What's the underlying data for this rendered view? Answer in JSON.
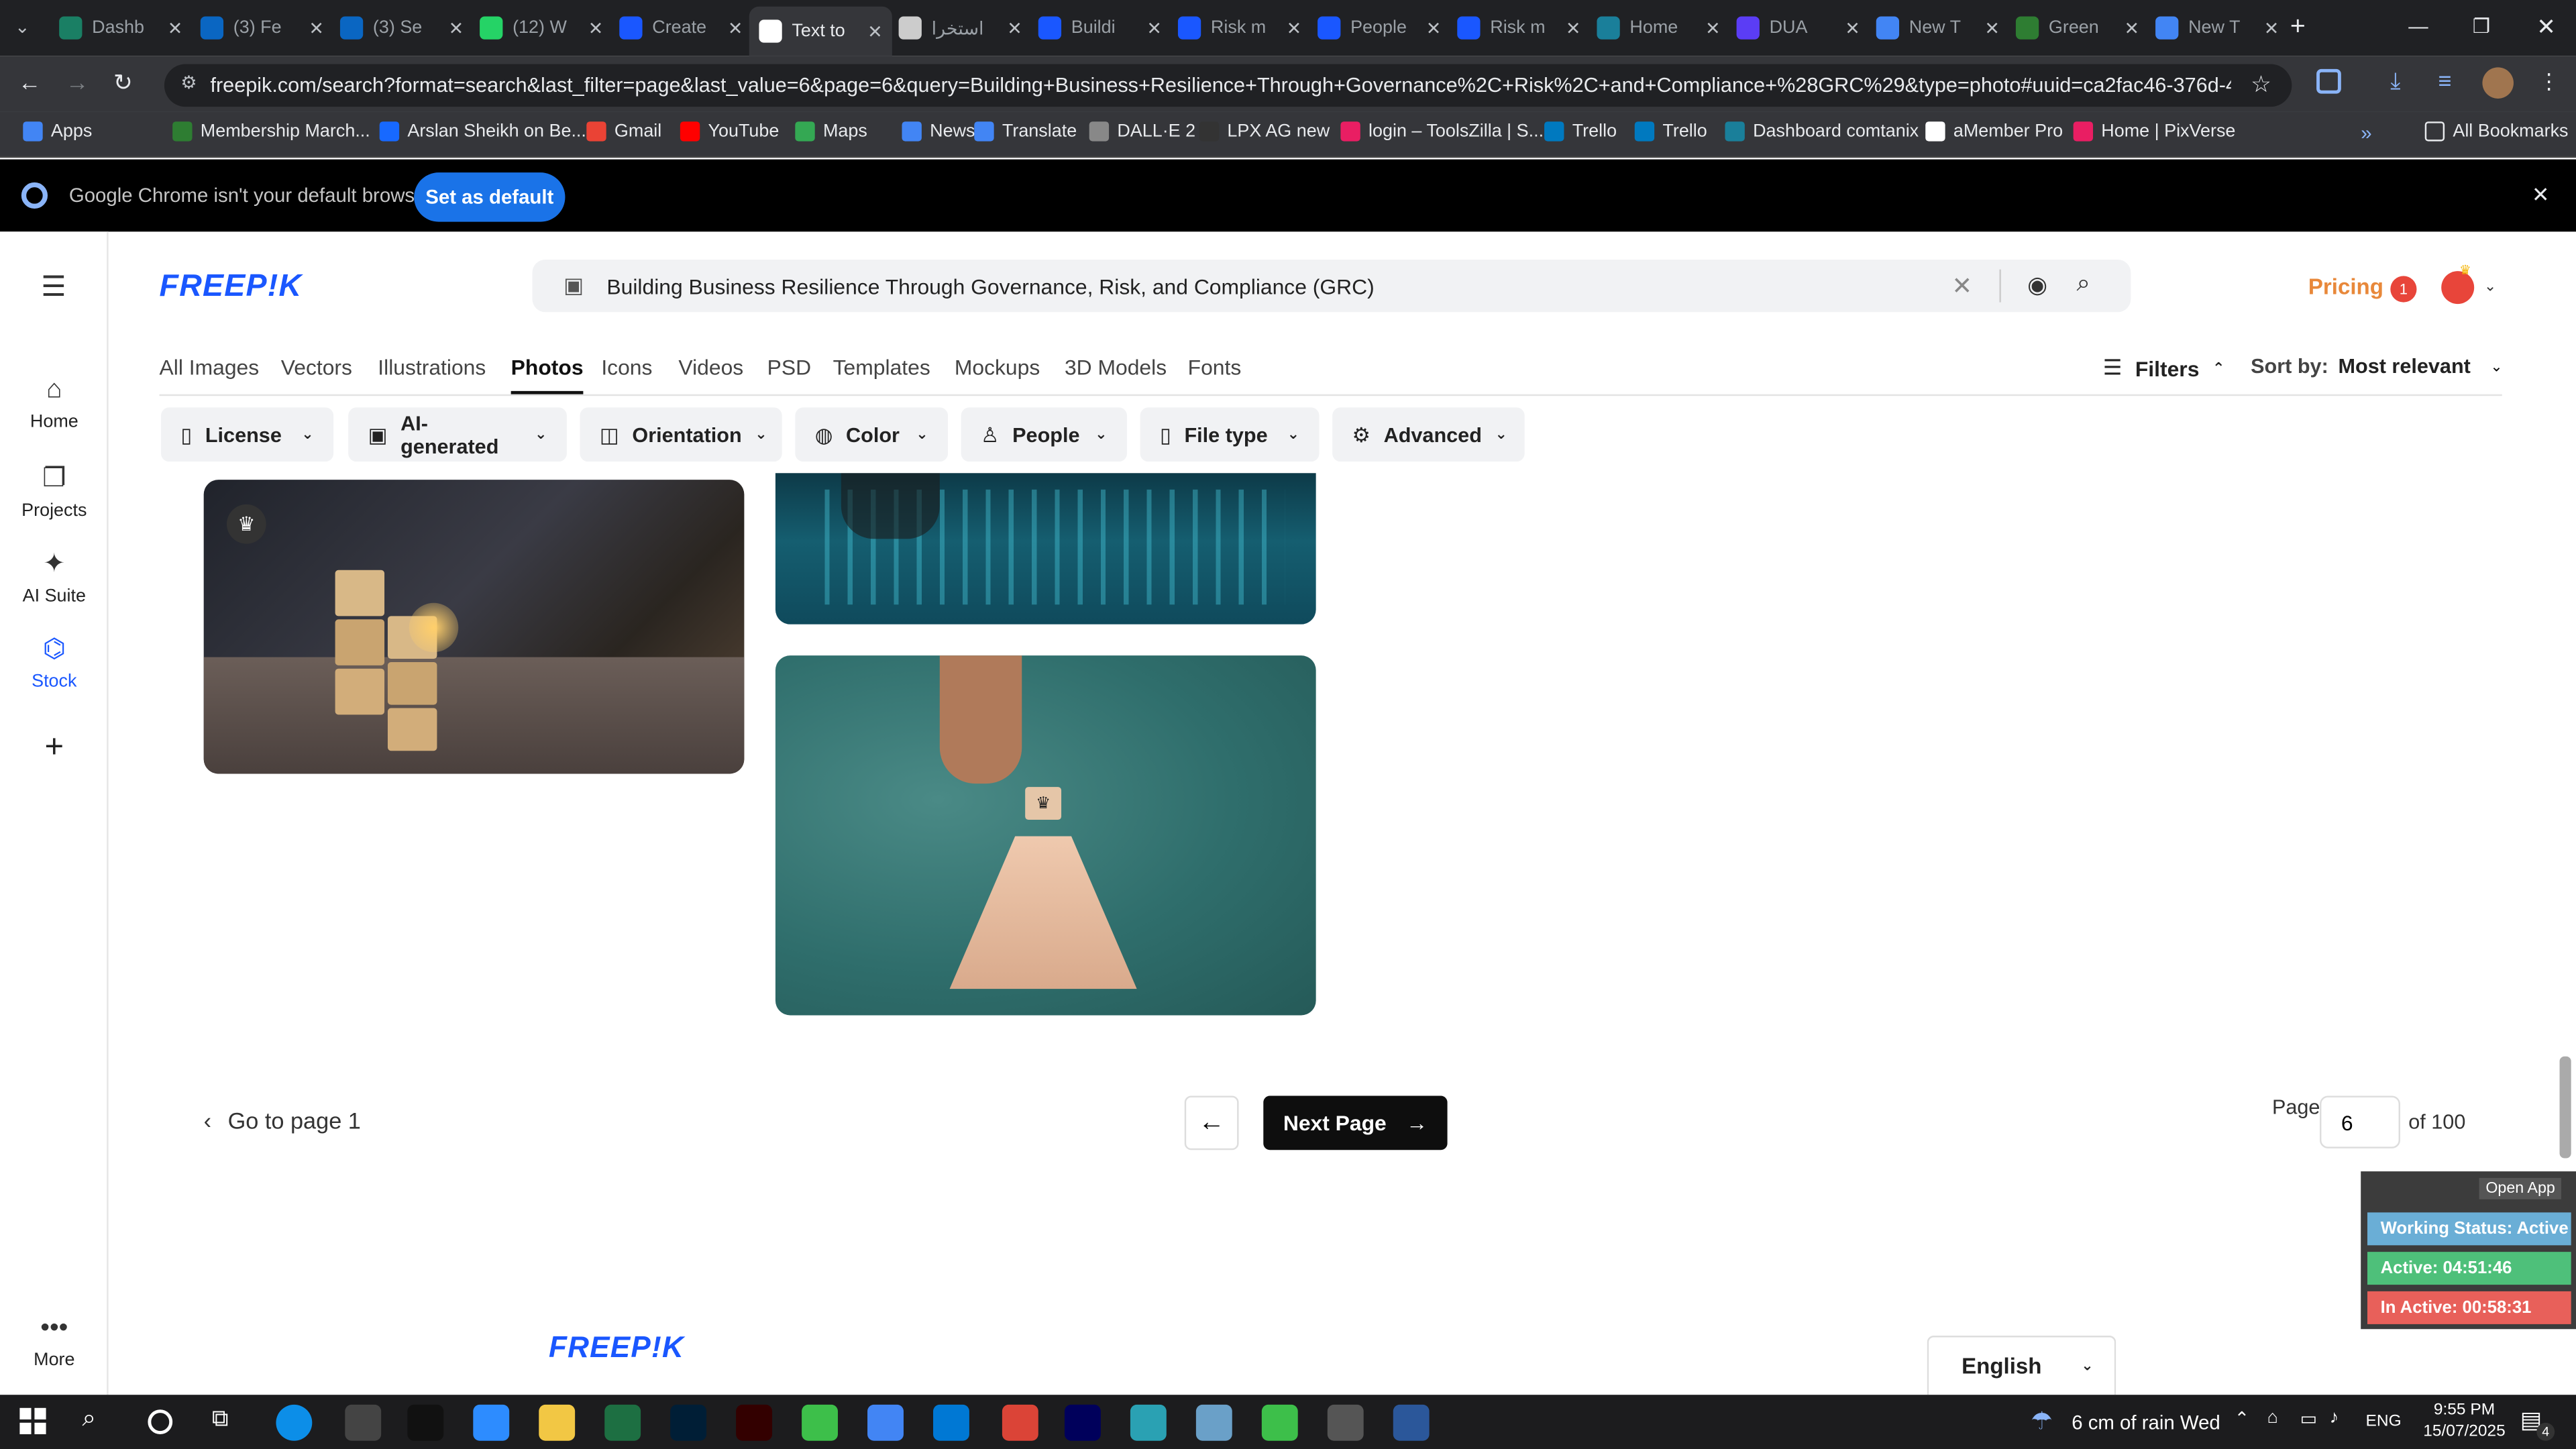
{
  "tabs": [
    {
      "label": "Dashb",
      "color": "#1a7f64"
    },
    {
      "label": "(3) Fe",
      "color": "#0a66c2"
    },
    {
      "label": "(3) Se",
      "color": "#0a66c2"
    },
    {
      "label": "(12) W",
      "color": "#25d366"
    },
    {
      "label": "Create",
      "color": "#1a57ff"
    },
    {
      "label": "Text to",
      "color": "#ffffff",
      "active": true
    },
    {
      "label": "استخرا",
      "color": "#cccccc"
    },
    {
      "label": "Buildi",
      "color": "#1a57ff"
    },
    {
      "label": "Risk m",
      "color": "#1a57ff"
    },
    {
      "label": "People",
      "color": "#1a57ff"
    },
    {
      "label": "Risk m",
      "color": "#1a57ff"
    },
    {
      "label": "Home",
      "color": "#1a7f9a"
    },
    {
      "label": "DUA",
      "color": "#5b3df5"
    },
    {
      "label": "New T",
      "color": "#4285f4"
    },
    {
      "label": "Green",
      "color": "#2e7d32"
    },
    {
      "label": "New T",
      "color": "#4285f4"
    }
  ],
  "url": "freepik.com/search?format=search&last_filter=page&last_value=6&page=6&query=Building+Business+Resilience+Through+Governance%2C+Risk%2C+and+Compliance+%28GRC%29&type=photo#uuid=ca2fac46-376d-4ca8-8abf-f91f3712...",
  "bookmarks": [
    {
      "label": "Apps",
      "color": "#4285f4"
    },
    {
      "label": "Membership March...",
      "color": "#2e7d32"
    },
    {
      "label": "Arslan Sheikh on Be...",
      "color": "#1769ff"
    },
    {
      "label": "Gmail",
      "color": "#ea4335"
    },
    {
      "label": "YouTube",
      "color": "#ff0000"
    },
    {
      "label": "Maps",
      "color": "#34a853"
    },
    {
      "label": "News",
      "color": "#4285f4"
    },
    {
      "label": "Translate",
      "color": "#4285f4"
    },
    {
      "label": "DALL·E 2",
      "color": "#888888"
    },
    {
      "label": "LPX AG new",
      "color": "#333333"
    },
    {
      "label": "login – ToolsZilla | S...",
      "color": "#e91e63"
    },
    {
      "label": "Trello",
      "color": "#0079bf"
    },
    {
      "label": "Trello",
      "color": "#0079bf"
    },
    {
      "label": "Dashboard comtanix",
      "color": "#1a7f9a"
    },
    {
      "label": "aMember Pro",
      "color": "#ffffff"
    },
    {
      "label": "Home | PixVerse",
      "color": "#e91e63"
    }
  ],
  "all_bookmarks": "All Bookmarks",
  "infobar": {
    "message": "Google Chrome isn't your default browser",
    "button": "Set as default"
  },
  "sidebar": {
    "home": "Home",
    "projects": "Projects",
    "ai_suite": "AI Suite",
    "stock": "Stock",
    "more": "More"
  },
  "logo": "FREEP!K",
  "search": {
    "value": "Building Business Resilience Through Governance, Risk, and Compliance (GRC)"
  },
  "pricing": "Pricing",
  "notif_count": "1",
  "nav": [
    "All Images",
    "Vectors",
    "Illustrations",
    "Photos",
    "Icons",
    "Videos",
    "PSD",
    "Templates",
    "Mockups",
    "3D Models",
    "Fonts"
  ],
  "filters_label": "Filters",
  "sort": {
    "label": "Sort by:",
    "value": "Most relevant"
  },
  "filters": [
    "License",
    "AI-generated",
    "Orientation",
    "Color",
    "People",
    "File type",
    "Advanced"
  ],
  "pagination": {
    "go_first": "Go to page 1",
    "next": "Next Page",
    "page_label": "Page",
    "page": "6",
    "of": "of 100"
  },
  "footer": {
    "logo": "FREEP!K",
    "language": "English"
  },
  "widget": {
    "open_app": "Open App",
    "status": "Working Status: Active",
    "active": "Active: 04:51:46",
    "inactive": "In Active: 00:58:31"
  },
  "taskbar": {
    "weather": "6 cm of rain Wed",
    "lang": "ENG",
    "time": "9:55 PM",
    "date": "15/07/2025",
    "notif": "4"
  },
  "colors": {
    "accent": "#1a57ff",
    "pricing": "#e8883a",
    "active": "#4ec07a",
    "inactive": "#e8605a",
    "status": "#6aaed6"
  }
}
